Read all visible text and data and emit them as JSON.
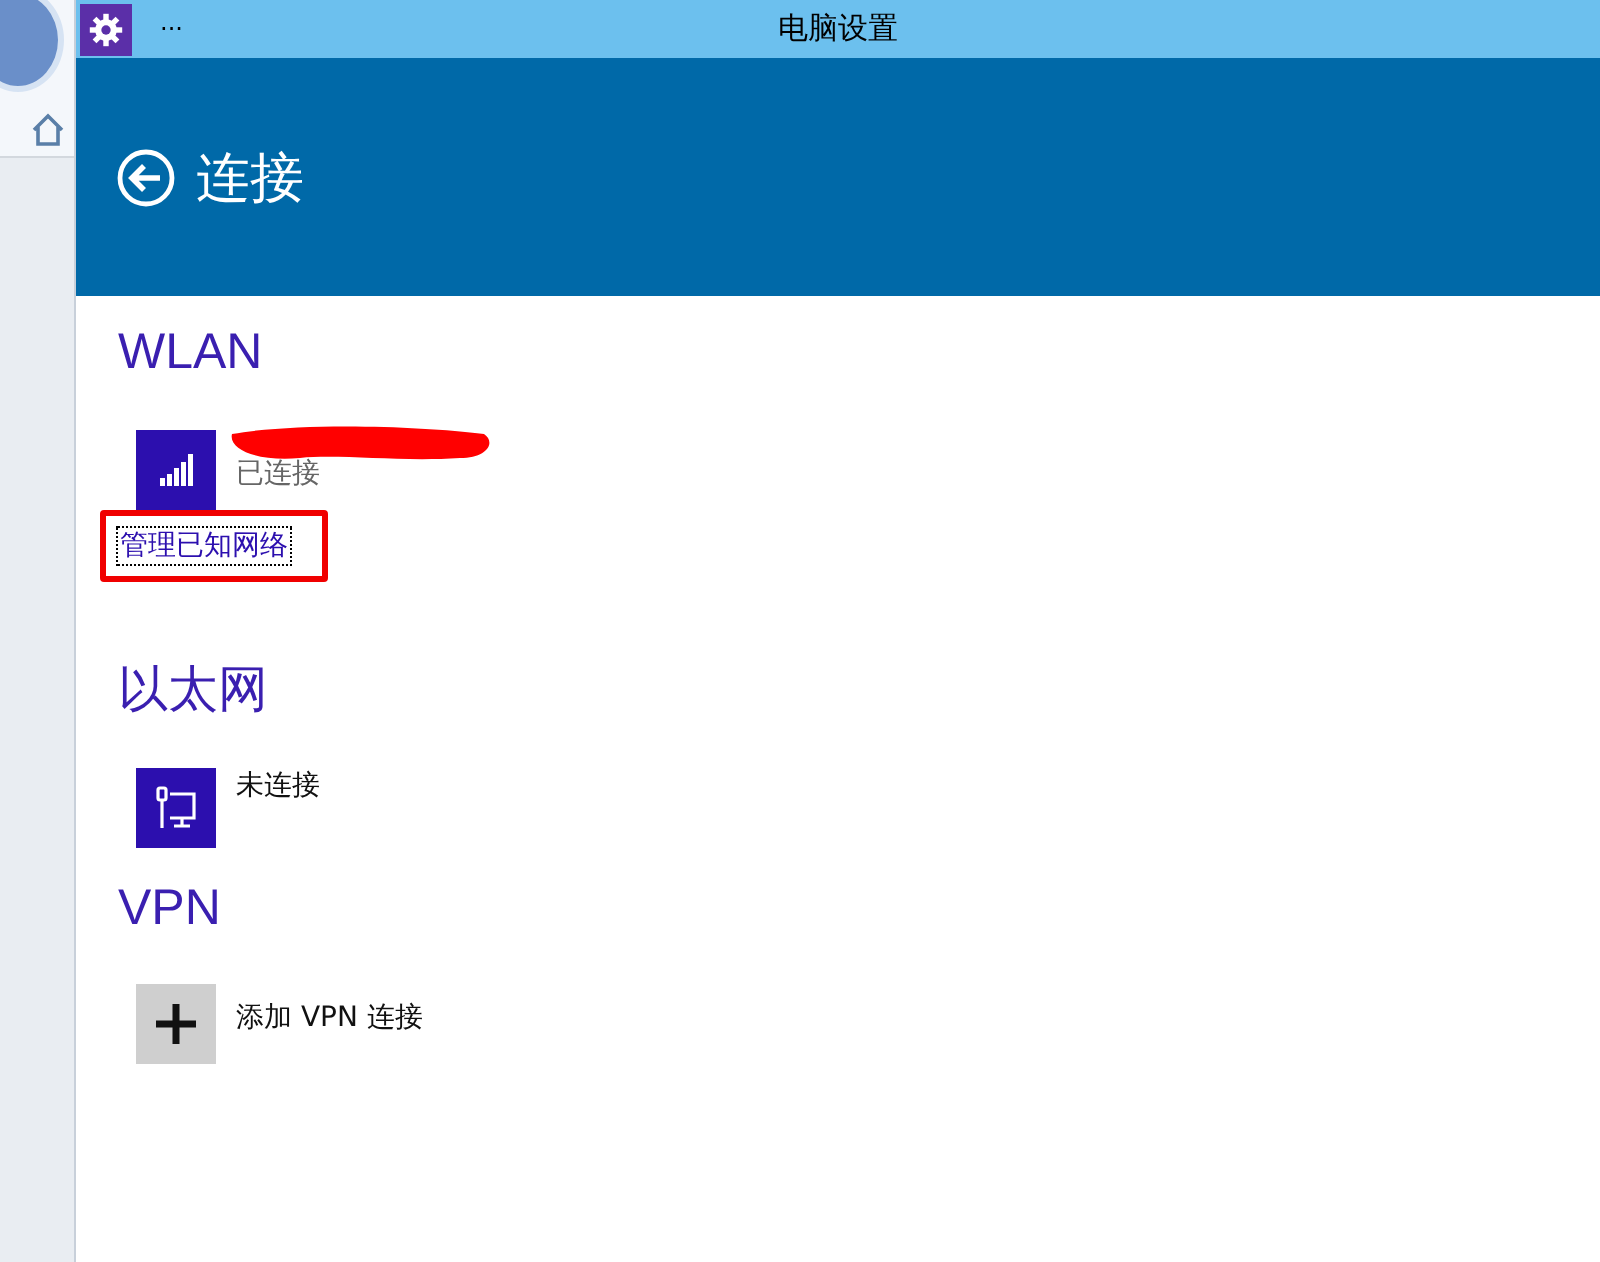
{
  "window": {
    "title": "电脑设置",
    "menu": "..."
  },
  "header": {
    "title": "连接"
  },
  "sections": [
    {
      "title": "WLAN",
      "items": [
        {
          "kind": "wifi",
          "status": "已连接",
          "redacted": true
        }
      ],
      "link": {
        "label": "管理已知网络",
        "highlighted": true
      }
    },
    {
      "title": "以太网",
      "items": [
        {
          "kind": "ethernet",
          "status": "未连接",
          "redacted": false
        }
      ]
    },
    {
      "title": "VPN",
      "items": [
        {
          "kind": "add",
          "status": "添加 VPN 连接",
          "redacted": false
        }
      ]
    }
  ]
}
